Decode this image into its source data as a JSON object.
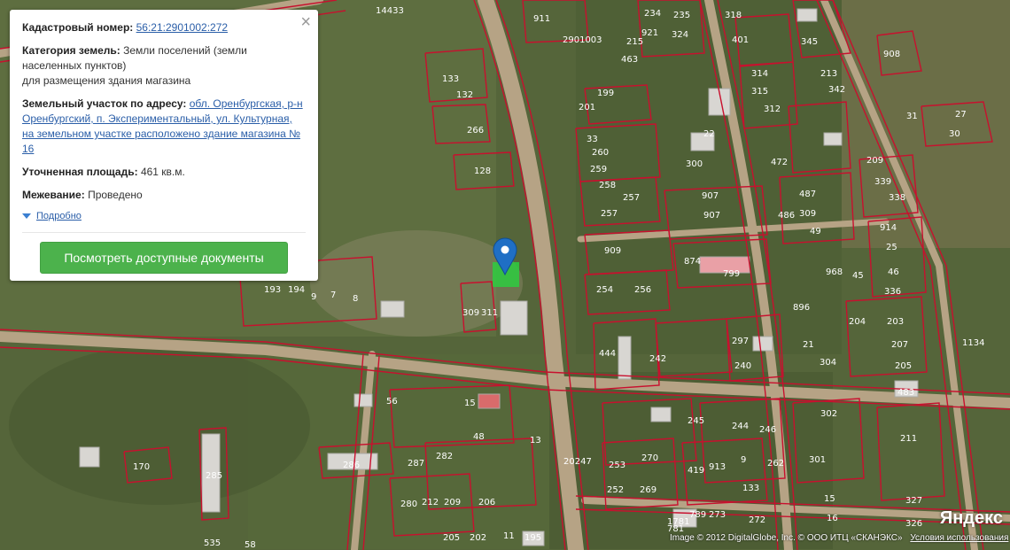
{
  "popup": {
    "cadastral_label": "Кадастровый номер:",
    "cadastral_value": "56:21:2901002:272",
    "category_label": "Категория земель:",
    "category_value": "Земли поселений (земли населенных пунктов)",
    "category_purpose": "для размещения здания магазина",
    "address_label": "Земельный участок по адресу:",
    "address_value": "обл. Оренбургская, р-н Оренбургский, п. Экспериментальный, ул. Культурная, на земельном участке расположено здание магазина № 16",
    "area_label": "Уточненная площадь:",
    "area_value": "461 кв.м.",
    "survey_label": "Межевание:",
    "survey_value": "Проведено",
    "more_label": "Подробно",
    "docs_button": "Посмотреть доступные документы",
    "close_symbol": "×"
  },
  "map": {
    "labels": {
      "l1": "14433",
      "l2": "911",
      "l3": "2901003",
      "l4": "234",
      "l5": "235",
      "l6": "318",
      "l7": "921",
      "l8": "324",
      "l9": "215",
      "l10": "401",
      "l11": "345",
      "l12": "463",
      "l13": "314",
      "l14": "213",
      "l15": "908",
      "l16": "315",
      "l17": "342",
      "l18": "133",
      "l19": "132",
      "l20": "199",
      "l21": "201",
      "l22": "312",
      "l23": "27",
      "l24": "31",
      "l25": "30",
      "l26": "266",
      "l27": "33",
      "l28": "22",
      "l29": "260",
      "l30": "472",
      "l31": "209",
      "l32": "128",
      "l33": "259",
      "l34": "300",
      "l35": "339",
      "l36": "258",
      "l37": "257",
      "l38": "907",
      "l39": "487",
      "l40": "338",
      "l41": "257",
      "l42": "907",
      "l43": "309",
      "l44": "486",
      "l45": "914",
      "l46": "909",
      "l47": "49",
      "l48": "874",
      "l49": "25",
      "l50": "799",
      "l51": "46",
      "l52": "254",
      "l53": "256",
      "l54": "968",
      "l55": "45",
      "l56": "336",
      "l57": "896",
      "l58": "309",
      "l59": "311",
      "l60": "203",
      "l61": "204",
      "l62": "1134",
      "l63": "297",
      "l64": "21",
      "l65": "207",
      "l66": "444",
      "l67": "242",
      "l68": "240",
      "l69": "304",
      "l70": "205",
      "l71": "193",
      "l72": "194",
      "l73": "9",
      "l74": "7",
      "l75": "8",
      "l76": "483",
      "l77": "56",
      "l78": "15",
      "l79": "48",
      "l80": "245",
      "l81": "244",
      "l82": "246",
      "l83": "302",
      "l84": "13",
      "l85": "211",
      "l86": "170",
      "l87": "285",
      "l88": "286",
      "l89": "287",
      "l90": "282",
      "l91": "20247",
      "l92": "253",
      "l93": "270",
      "l94": "419",
      "l95": "913",
      "l96": "9",
      "l97": "262",
      "l98": "301",
      "l99": "252",
      "l100": "269",
      "l101": "133",
      "l102": "15",
      "l103": "280",
      "l104": "212",
      "l105": "209",
      "l106": "206",
      "l107": "327",
      "l108": "535",
      "l109": "58",
      "l110": "205",
      "l111": "202",
      "l112": "11",
      "l113": "195",
      "l114": "1781",
      "l115": "789",
      "l116": "273",
      "l117": "272",
      "l118": "16",
      "l119": "326",
      "l120": "781"
    }
  },
  "attribution": {
    "copyright": "Image © 2012 DigitalGlobe, Inc. © ООО ИТЦ «СКАНЭКС»",
    "terms_link": "Условия использования",
    "logo": "Яндекс"
  }
}
